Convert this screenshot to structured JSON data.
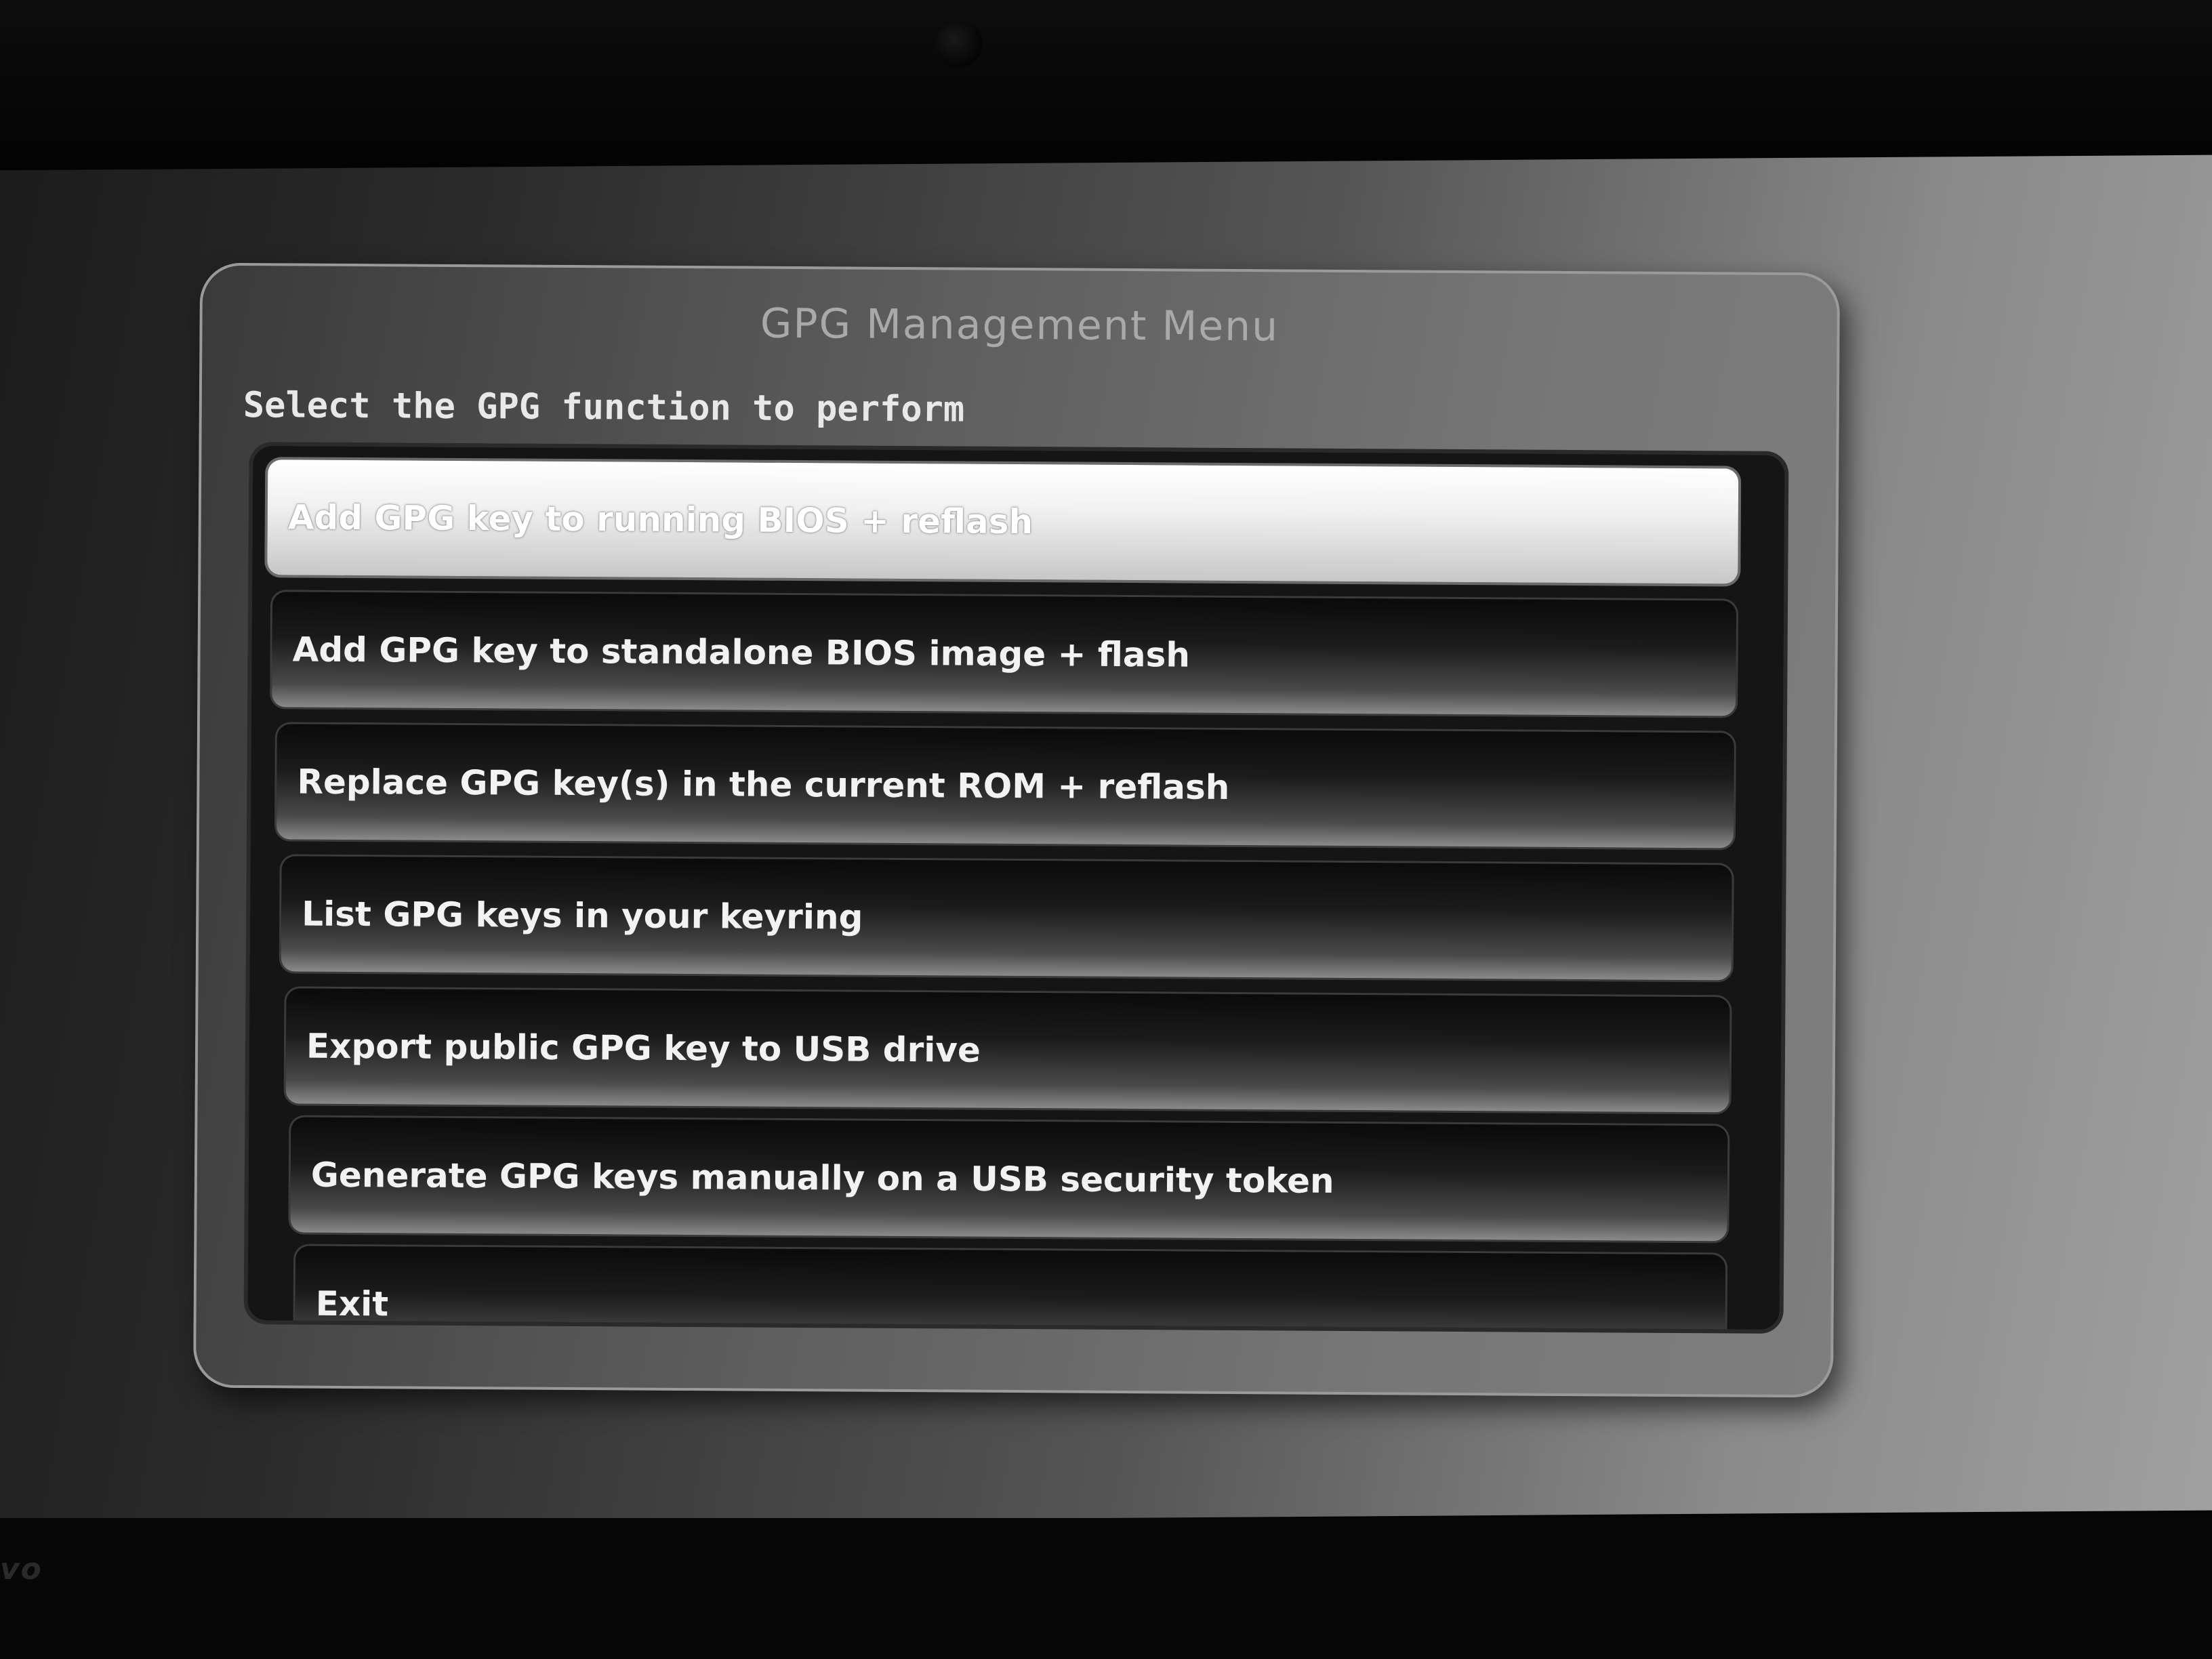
{
  "dialog": {
    "title": "GPG Management Menu",
    "prompt": "Select the GPG function to perform"
  },
  "menu": {
    "selected_index": 0,
    "items": [
      {
        "label": "Add GPG key to running BIOS + reflash"
      },
      {
        "label": "Add GPG key to standalone BIOS image + flash"
      },
      {
        "label": "Replace GPG key(s) in the current ROM + reflash"
      },
      {
        "label": "List GPG keys in your keyring"
      },
      {
        "label": "Export public GPG key to USB drive"
      },
      {
        "label": "Generate GPG keys manually on a USB security token"
      },
      {
        "label": "Exit"
      }
    ]
  },
  "bezel": {
    "brand": "vo"
  },
  "colors": {
    "selected_item": "#f0f0f0",
    "item_background": "#1b1b1b",
    "dialog_background": "#5d5d5d",
    "title_text": "#a9a9a9"
  }
}
